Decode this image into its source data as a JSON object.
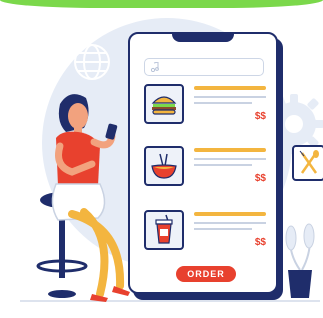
{
  "search": {
    "placeholder": ""
  },
  "menu": {
    "items": [
      {
        "icon": "burger-icon",
        "price": "$$"
      },
      {
        "icon": "noodle-bowl-icon",
        "price": "$$"
      },
      {
        "icon": "soda-cup-icon",
        "price": "$$"
      }
    ],
    "order_label": "ORDER"
  },
  "colors": {
    "accent_top": "#7bd84b",
    "navy": "#1f2d6b",
    "price_red": "#e8412e",
    "title_bar_yellow": "#f3b53f",
    "background_blob": "#e6ecf6"
  },
  "decor": {
    "left_icon": "globe-icon",
    "right_icon": "gear-icon",
    "side_card_icon": "fork-spoon-icon"
  }
}
